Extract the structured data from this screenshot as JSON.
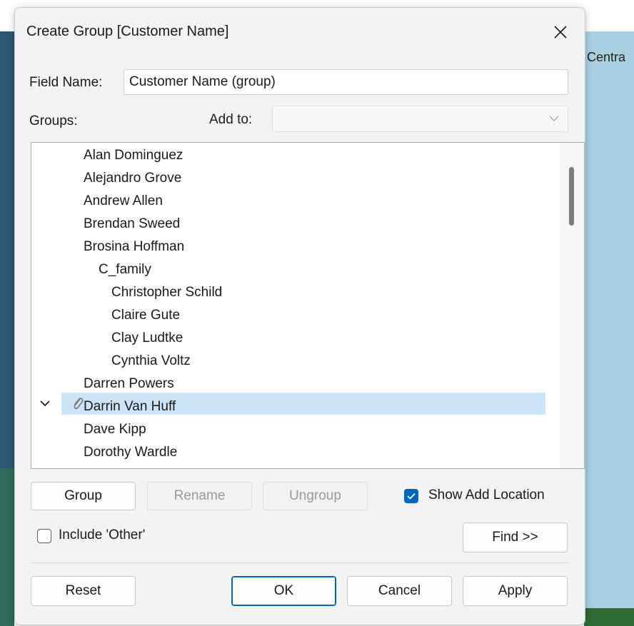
{
  "background": {
    "right_text": "Centra"
  },
  "dialog": {
    "title": "Create Group [Customer Name]",
    "field_name_label": "Field Name:",
    "field_name_value": "Customer Name (group)",
    "groups_label": "Groups:",
    "add_to_label": "Add to:",
    "add_to_value": "",
    "list": [
      {
        "label": "Alan Dominguez"
      },
      {
        "label": "Alejandro Grove"
      },
      {
        "label": "Andrew Allen"
      },
      {
        "label": "Brendan Sweed"
      },
      {
        "label": "Brosina Hoffman"
      },
      {
        "label": "C_family",
        "group": true,
        "expanded": true,
        "selected": true,
        "icon": "paperclip-icon"
      },
      {
        "label": "Christopher Schild",
        "child": true
      },
      {
        "label": "Claire Gute",
        "child": true
      },
      {
        "label": "Clay Ludtke",
        "child": true
      },
      {
        "label": "Cynthia Voltz",
        "child": true
      },
      {
        "label": "Darren Powers"
      },
      {
        "label": "Darrin Van Huff"
      },
      {
        "label": "Dave Kipp"
      },
      {
        "label": "Dorothy Wardle"
      }
    ],
    "buttons": {
      "group": "Group",
      "rename": "Rename",
      "ungroup": "Ungroup",
      "find": "Find >>",
      "reset": "Reset",
      "ok": "OK",
      "cancel": "Cancel",
      "apply": "Apply"
    },
    "show_add_location": {
      "label": "Show Add Location",
      "checked": true
    },
    "include_other": {
      "label": "Include 'Other'",
      "checked": false
    },
    "colors": {
      "accent": "#0067c0",
      "selection": "#cce4f7"
    }
  }
}
